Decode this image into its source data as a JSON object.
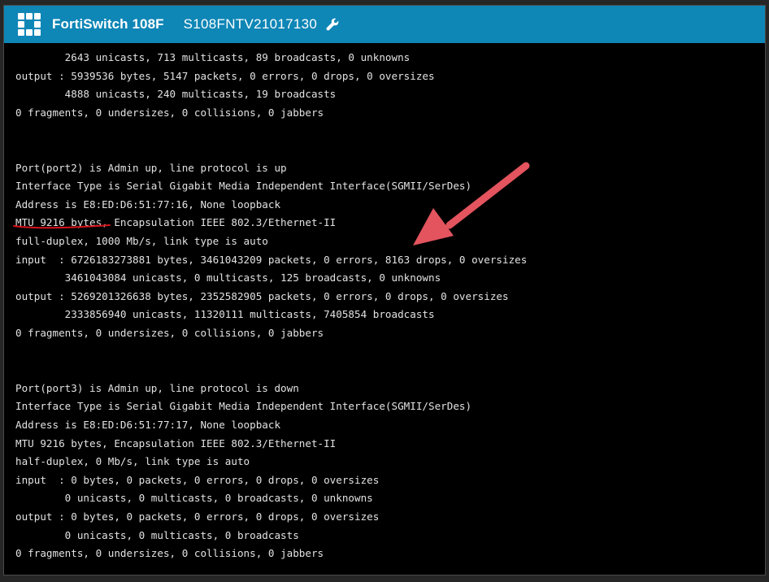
{
  "window": {
    "product_name": "FortiSwitch 108F",
    "serial_number": "S108FNTV21017130",
    "logo_icon": "fortinet-logo",
    "settings_icon": "wrench-icon",
    "brand_color": "#0e86b6"
  },
  "terminal": {
    "lines": [
      "        2643 unicasts, 713 multicasts, 89 broadcasts, 0 unknowns",
      "output : 5939536 bytes, 5147 packets, 0 errors, 0 drops, 0 oversizes",
      "        4888 unicasts, 240 multicasts, 19 broadcasts",
      "0 fragments, 0 undersizes, 0 collisions, 0 jabbers",
      "",
      "",
      "Port(port2) is Admin up, line protocol is up",
      "Interface Type is Serial Gigabit Media Independent Interface(SGMII/SerDes)",
      "Address is E8:ED:D6:51:77:16, None loopback",
      "MTU 9216 bytes, Encapsulation IEEE 802.3/Ethernet-II",
      "full-duplex, 1000 Mb/s, link type is auto",
      "input  : 6726183273881 bytes, 3461043209 packets, 0 errors, 8163 drops, 0 oversizes",
      "        3461043084 unicasts, 0 multicasts, 125 broadcasts, 0 unknowns",
      "output : 5269201326638 bytes, 2352582905 packets, 0 errors, 0 drops, 0 oversizes",
      "        2333856940 unicasts, 11320111 multicasts, 7405854 broadcasts",
      "0 fragments, 0 undersizes, 0 collisions, 0 jabbers",
      "",
      "",
      "Port(port3) is Admin up, line protocol is down",
      "Interface Type is Serial Gigabit Media Independent Interface(SGMII/SerDes)",
      "Address is E8:ED:D6:51:77:17, None loopback",
      "MTU 9216 bytes, Encapsulation IEEE 802.3/Ethernet-II",
      "half-duplex, 0 Mb/s, link type is auto",
      "input  : 0 bytes, 0 packets, 0 errors, 0 drops, 0 oversizes",
      "        0 unicasts, 0 multicasts, 0 broadcasts, 0 unknowns",
      "output : 0 bytes, 0 packets, 0 errors, 0 drops, 0 oversizes",
      "        0 unicasts, 0 multicasts, 0 broadcasts",
      "0 fragments, 0 undersizes, 0 collisions, 0 jabbers"
    ]
  },
  "annotations": {
    "underline_color": "#d6131b",
    "arrow_color": "#e3545e",
    "underline_target": "MTU 9216 bytes",
    "arrow_target": "8163 drops"
  }
}
